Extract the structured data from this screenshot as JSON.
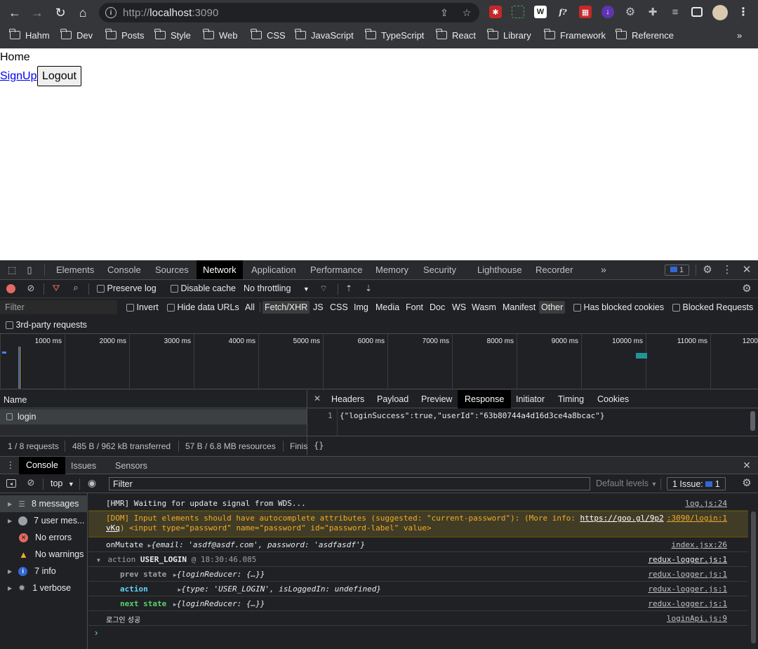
{
  "browser": {
    "url_scheme": "http://",
    "url_host": "localhost",
    "url_port": ":3090",
    "bookmarks": [
      "Hahm",
      "Dev",
      "Posts",
      "Style",
      "Web",
      "CSS",
      "JavaScript",
      "TypeScript",
      "React",
      "Library",
      "Framework",
      "Reference"
    ]
  },
  "page": {
    "home_text": "Home",
    "signup_link": "SignUp",
    "logout_button": "Logout"
  },
  "devtools": {
    "tabs": [
      "Elements",
      "Console",
      "Sources",
      "Network",
      "Application",
      "Performance",
      "Memory",
      "Security",
      "Lighthouse",
      "Recorder"
    ],
    "active_tab": "Network",
    "issues_badge": "1",
    "network": {
      "preserve_log": "Preserve log",
      "disable_cache": "Disable cache",
      "throttling": "No throttling",
      "filter_placeholder": "Filter",
      "invert": "Invert",
      "hide_data_urls": "Hide data URLs",
      "type_filters": [
        "All",
        "Fetch/XHR",
        "JS",
        "CSS",
        "Img",
        "Media",
        "Font",
        "Doc",
        "WS",
        "Wasm",
        "Manifest",
        "Other"
      ],
      "has_blocked_cookies": "Has blocked cookies",
      "blocked_requests": "Blocked Requests",
      "third_party": "3rd-party requests",
      "timeline_ticks": [
        "1000 ms",
        "2000 ms",
        "3000 ms",
        "4000 ms",
        "5000 ms",
        "6000 ms",
        "7000 ms",
        "8000 ms",
        "9000 ms",
        "10000 ms",
        "11000 ms",
        "1200"
      ],
      "name_header": "Name",
      "requests": [
        "login"
      ],
      "detail_tabs": [
        "Headers",
        "Payload",
        "Preview",
        "Response",
        "Initiator",
        "Timing",
        "Cookies"
      ],
      "active_detail_tab": "Response",
      "response_line_no": "1",
      "response_body": "{\"loginSuccess\":true,\"userId\":\"63b80744a4d16d3ce4a8bcac\"}",
      "status": {
        "requests": "1 / 8 requests",
        "transferred": "485 B / 962 kB transferred",
        "resources": "57 B / 6.8 MB resources",
        "finish": "Finis"
      },
      "pretty_print": "{}"
    },
    "console": {
      "tabs": [
        "Console",
        "Issues",
        "Sensors"
      ],
      "context": "top",
      "filter_placeholder": "Filter",
      "levels": "Default levels",
      "issues_label": "1 Issue:",
      "issues_count": "1",
      "sidebar": [
        "8 messages",
        "7 user mes...",
        "No errors",
        "No warnings",
        "7 info",
        "1 verbose"
      ],
      "messages": {
        "hmr": "[HMR] Waiting for update signal from WDS...",
        "hmr_src": "log.js:24",
        "dom_1": "[DOM] Input elements should have autocomplete attributes (suggested: \"current-password\"): (More info: ",
        "dom_link": "https://goo.gl/9p2",
        "dom_link2": "vKq",
        "dom_2": ")   <input type=\"password\" name=\"password\" id=\"password-label\" value>",
        "dom_src": ":3090/login:1",
        "onmutate_label": "onMutate",
        "onmutate_obj": "{email: 'asdf@asdf.com', password: 'asdfasdf'}",
        "onmutate_src": "index.jsx:26",
        "action_prefix": "action",
        "action_name": "USER_LOGIN",
        "action_time": "@ 18:30:46.085",
        "redux_src": "redux-logger.js:1",
        "prev_state": "prev state",
        "prev_obj": "{loginReducer: {…}}",
        "action_label": "action",
        "action_obj": "{type: 'USER_LOGIN', isLoggedIn: undefined}",
        "next_state": "next state",
        "next_obj": "{loginReducer: {…}}",
        "login_ok": "로그인 성공",
        "login_src": "loginApi.js:9"
      }
    }
  },
  "colors": {
    "chrome_bg": "#35363a",
    "devtools_bg": "#202124",
    "warning_bg": "#413c26",
    "warning_text": "#f2ab26",
    "info_blue": "#3367d6",
    "red": "#e46962",
    "green": "#5bd26d"
  }
}
